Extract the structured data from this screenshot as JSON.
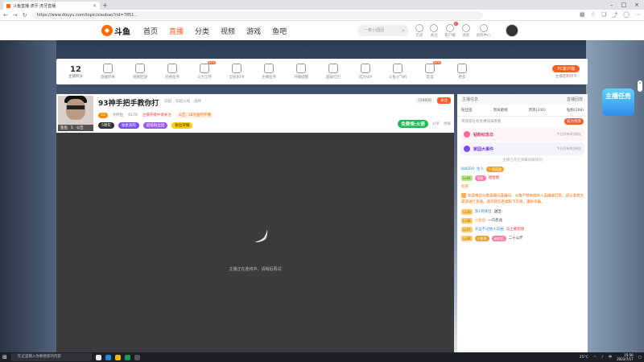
{
  "browser": {
    "tab_title": "斗鱼直播 虎牙 虎牙直播",
    "url": "https://www.douyu.com/topic/xiaobao?rid=7851...",
    "ext_icons": [
      "grid-icon",
      "star-icon",
      "collection-icon",
      "share-icon",
      "user-icon",
      "settings-icon"
    ]
  },
  "header": {
    "logo_text": "斗鱼",
    "nav": [
      "首页",
      "直播",
      "分类",
      "视频",
      "游戏",
      "鱼吧"
    ],
    "search_placeholder": "一条小团团",
    "right": [
      {
        "label": "历史",
        "badge": ""
      },
      {
        "label": "关注",
        "badge": ""
      },
      {
        "label": "客户端",
        "badge": "4"
      },
      {
        "label": "消息",
        "badge": ""
      },
      {
        "label": "创作中心",
        "badge": ""
      }
    ]
  },
  "toolbar": {
    "count": "12",
    "count_label": "主播积分",
    "items": [
      {
        "label": "直播开关",
        "new": ""
      },
      {
        "label": "视频回放",
        "new": ""
      },
      {
        "label": "尼格任务",
        "new": ""
      },
      {
        "label": "火力全开",
        "new": "NEW"
      },
      {
        "label": "全民乐FK",
        "new": ""
      },
      {
        "label": "主播任务",
        "new": ""
      },
      {
        "label": "开播提醒",
        "new": ""
      },
      {
        "label": "超级红包",
        "new": ""
      },
      {
        "label": "成为VIP",
        "new": ""
      },
      {
        "label": "斗鱼小飞机",
        "new": ""
      },
      {
        "label": "友谊",
        "new": "NEW"
      },
      {
        "label": "更多",
        "new": ""
      }
    ],
    "client_btn": "PC客户端",
    "client_sub": "主播定制月卡"
  },
  "streamer": {
    "title": "93神手把手教你打",
    "category": [
      "穿越",
      "穿越火线",
      "战神",
      "..."
    ],
    "level": "23",
    "name_label": "大胖鱼",
    "hot": "6170",
    "notice1": "主播开播中请关注",
    "notice2": "公告: 18点准时开播",
    "tags": [
      "5周年",
      "福星高照",
      "超级粉丝团",
      "粉丝荣耀"
    ],
    "badge_name": "鱼鱼",
    "badge_rank": "1",
    "badge_text": "公告",
    "hot_count": "728600",
    "follow": "关注",
    "free_gift": "免费领:火箭",
    "share": "分享",
    "report": "举报"
  },
  "player": {
    "message": "主播正在连线中，请稍后再试"
  },
  "chat": {
    "head_left": "主播信息",
    "head_right": "直播回放",
    "tabs": [
      "粉丝团",
      "周贡献榜",
      "贵宾(240)",
      "钻粉(108)"
    ],
    "rank_text": "贵宾席位有优惠快来看看",
    "rank_btn": "成为贵宾",
    "card1": {
      "title": "钻粉纪念日",
      "sub": "今日共有0位粉丝"
    },
    "card2": {
      "title": "家园大事件",
      "sub": "今日共有0位粉丝"
    },
    "divider": "主播已开启弹幕屏蔽规则",
    "messages": [
      {
        "lvl": "",
        "name": "BADDA: 古人",
        "text": "",
        "pill": "一剑英雄"
      },
      {
        "lvl": "Lv44",
        "name": "",
        "text": "哈哈哈",
        "pill": "鱼鱼"
      },
      {
        "lvl": "",
        "name": "乾隆",
        "text": "",
        "pill": ""
      }
    ],
    "system": "欢迎来到斗鱼直播间直播间，斗鱼严禁未成年人直播或打赏，请认准官方渠道进行充值。请勿轻信各类私下交易，谨防诈骗。",
    "messages2": [
      {
        "lvl": "Lv39",
        "name": "多1到排位",
        "text": "送出:",
        "pill": ""
      },
      {
        "lvl": "Lv38",
        "name": "小鱼鱼",
        "text": "一只恐龙",
        "pill": ""
      },
      {
        "lvl": "Lv17",
        "name": "幸运不过他人日抽",
        "text": "马上要花钱",
        "pill": ""
      },
      {
        "lvl": "Lv38",
        "name": "小鱼鱼",
        "text": "二十公斤",
        "pill": "粉丝团"
      }
    ]
  },
  "side": {
    "badge": "主播任务"
  },
  "taskbar": {
    "search": "在这里输入你要搜索的内容",
    "weather": "25°C",
    "lang": "中",
    "time": "15:56",
    "date": "2022/7/17"
  }
}
